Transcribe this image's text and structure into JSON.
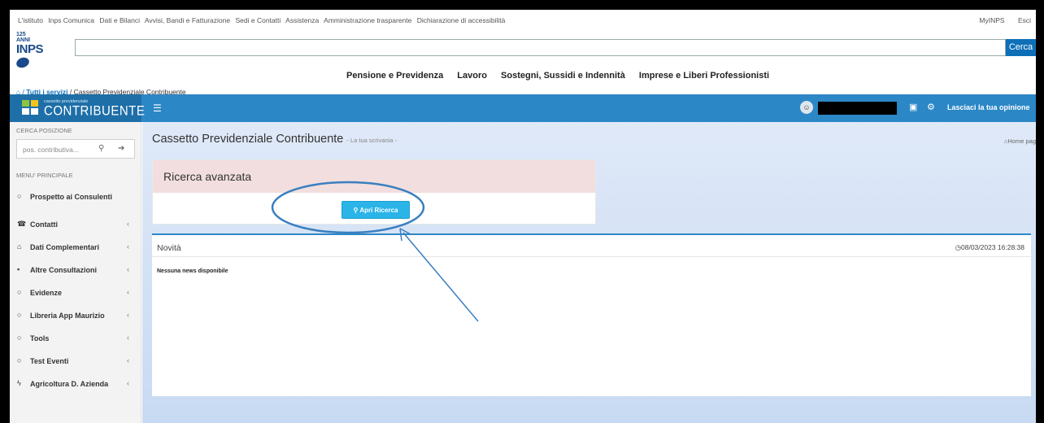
{
  "top_links": [
    "L'istituto",
    "Inps Comunica",
    "Dati e Bilanci",
    "Avvisi, Bandi e Fatturazione",
    "Sedi e Contatti",
    "Assistenza",
    "Amministrazione trasparente",
    "Dichiarazione di accessibilità"
  ],
  "top_right": {
    "myinps": "MyINPS",
    "esci": "Esci"
  },
  "logo": {
    "anni": "125 ANNI",
    "name": "INPS"
  },
  "search": {
    "button": "Cerca"
  },
  "main_nav": [
    "Pensione e Previdenza",
    "Lavoro",
    "Sostegni, Sussidi e Indennità",
    "Imprese e Liberi Professionisti"
  ],
  "breadcrumb": {
    "home": "⌂ / ",
    "all_services": "Tutti i servizi",
    "current": " / Cassetto Previdenziale Contribuente"
  },
  "brand": {
    "sub": "cassetto previdenziale",
    "name": "CONTRIBUENTE"
  },
  "appbar": {
    "opinion": "Lasciaci la tua opinione"
  },
  "sidebar": {
    "search_caption": "CERCA POSIZIONE",
    "search_placeholder": "pos. contributiva...",
    "menu_caption": "MENU' PRINCIPALE",
    "items": [
      {
        "label": "Prospetto ai Consulenti",
        "icon": "○",
        "chev": ""
      },
      {
        "label": "Contatti",
        "icon": "☎",
        "chev": "‹"
      },
      {
        "label": "Dati Complementari",
        "icon": "⌂",
        "chev": "‹"
      },
      {
        "label": "Altre Consultazioni",
        "icon": "▪",
        "chev": "‹"
      },
      {
        "label": "Evidenze",
        "icon": "○",
        "chev": "‹"
      },
      {
        "label": "Libreria App Maurizio",
        "icon": "○",
        "chev": "‹"
      },
      {
        "label": "Tools",
        "icon": "○",
        "chev": "‹"
      },
      {
        "label": "Test Eventi",
        "icon": "○",
        "chev": "‹"
      },
      {
        "label": "Agricoltura D. Azienda",
        "icon": "ϟ",
        "chev": "‹"
      }
    ]
  },
  "main": {
    "title": "Cassetto Previdenziale Contribuente",
    "subtitle": "- La tua scrivania -",
    "home_link": "⌂Home pag",
    "ricerca": {
      "title": "Ricerca avanzata",
      "button": "Apri Ricerca"
    },
    "novita": {
      "title": "Novità",
      "date": "08/03/2023 16:28:38",
      "empty": "Nessuna news disponibile"
    }
  },
  "colors": {
    "brand_blue": "#2c87c6",
    "button_cyan": "#2ab4e8",
    "annotation": "#3a7fc0"
  }
}
